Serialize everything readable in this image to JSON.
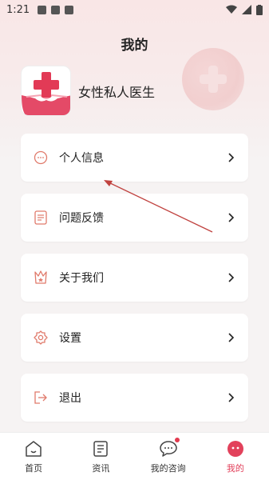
{
  "status_bar": {
    "time": "1:21"
  },
  "page": {
    "title": "我的"
  },
  "app": {
    "name": "女性私人医生"
  },
  "menu": [
    {
      "label": "个人信息",
      "icon": "chat-bubble-icon"
    },
    {
      "label": "问题反馈",
      "icon": "feedback-doc-icon"
    },
    {
      "label": "关于我们",
      "icon": "star-badge-icon"
    },
    {
      "label": "设置",
      "icon": "gear-icon"
    },
    {
      "label": "退出",
      "icon": "logout-icon"
    }
  ],
  "bottom_nav": [
    {
      "label": "首页",
      "icon": "home-icon"
    },
    {
      "label": "资讯",
      "icon": "news-icon"
    },
    {
      "label": "我的咨询",
      "icon": "consult-icon",
      "has_dot": true
    },
    {
      "label": "我的",
      "icon": "profile-icon",
      "active": true
    }
  ],
  "colors": {
    "accent": "#e2415b",
    "icon_stroke": "#e07a6b"
  }
}
